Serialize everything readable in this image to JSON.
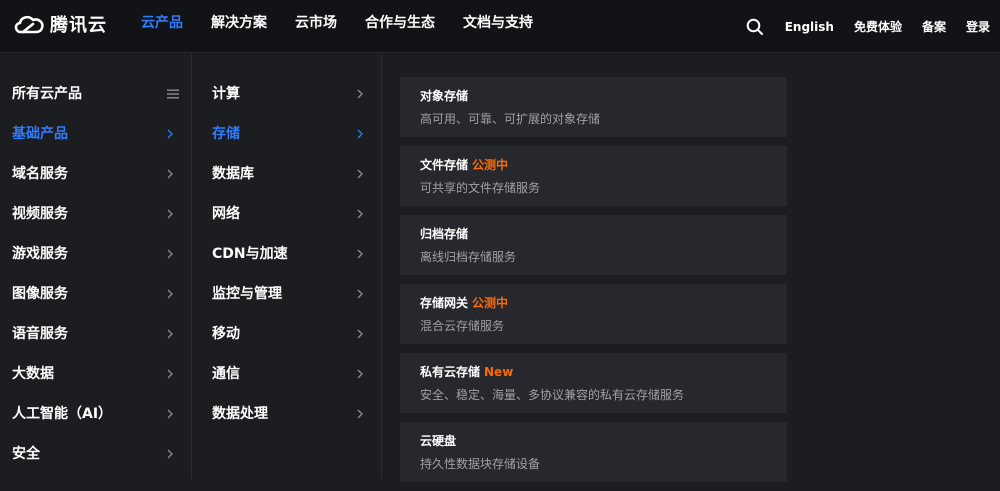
{
  "header": {
    "logo_text": "腾讯云",
    "nav": [
      "云产品",
      "解决方案",
      "云市场",
      "合作与生态",
      "文档与支持"
    ],
    "right_links": [
      "English",
      "免费体验",
      "备案",
      "登录"
    ]
  },
  "categories": [
    "所有云产品",
    "基础产品",
    "域名服务",
    "视频服务",
    "游戏服务",
    "图像服务",
    "语音服务",
    "大数据",
    "人工智能（AI）",
    "安全"
  ],
  "subcategories": [
    "计算",
    "存储",
    "数据库",
    "网络",
    "CDN与加速",
    "监控与管理",
    "移动",
    "通信",
    "数据处理"
  ],
  "products": [
    {
      "title": "对象存储",
      "badge": "",
      "desc": "高可用、可靠、可扩展的对象存储"
    },
    {
      "title": "文件存储",
      "badge": "公测中",
      "desc": "可共享的文件存储服务"
    },
    {
      "title": "归档存储",
      "badge": "",
      "desc": "离线归档存储服务"
    },
    {
      "title": "存储网关",
      "badge": "公测中",
      "desc": "混合云存储服务"
    },
    {
      "title": "私有云存储",
      "badge": "New",
      "desc": "安全、稳定、海量、多协议兼容的私有云存储服务"
    },
    {
      "title": "云硬盘",
      "badge": "",
      "desc": "持久性数据块存储设备"
    }
  ],
  "colors": {
    "accent": "#2e7dff",
    "badge": "#ff6a00"
  }
}
